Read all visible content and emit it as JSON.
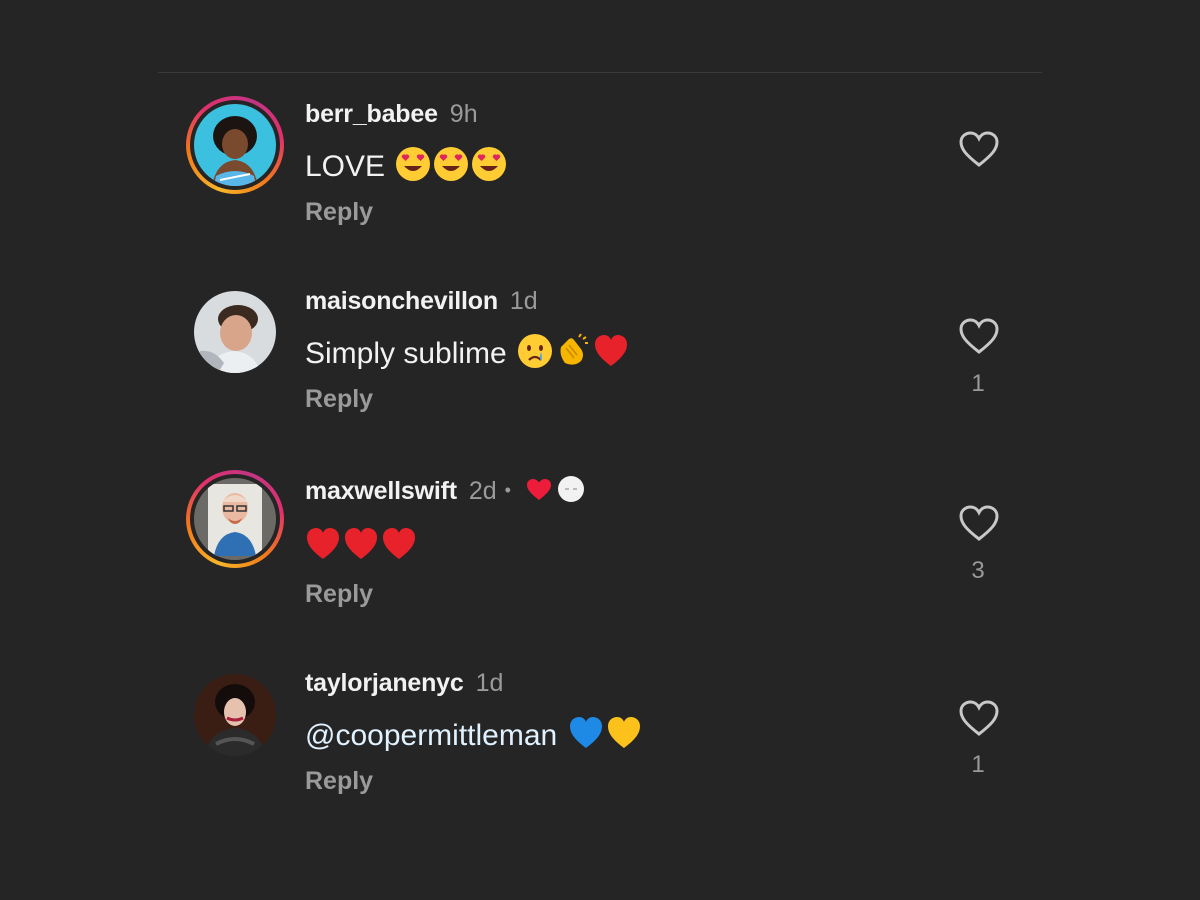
{
  "comments": [
    {
      "username": "berr_babee",
      "time": "9h",
      "text": "LOVE",
      "emojis": [
        "heart-eyes",
        "heart-eyes",
        "heart-eyes"
      ],
      "reply_label": "Reply",
      "likes": "",
      "story_ring": true
    },
    {
      "username": "maisonchevillon",
      "time": "1d",
      "text": "Simply sublime",
      "emojis": [
        "crying-face",
        "clapping-hands",
        "red-heart"
      ],
      "reply_label": "Reply",
      "likes": "1",
      "story_ring": false
    },
    {
      "username": "maxwellswift",
      "time": "2d",
      "separator": "•",
      "author_reactions": [
        "red-heart",
        "author-avatar"
      ],
      "text": "",
      "emojis": [
        "red-heart",
        "red-heart",
        "red-heart"
      ],
      "reply_label": "Reply",
      "likes": "3",
      "story_ring": true
    },
    {
      "username": "taylorjanenyc",
      "time": "1d",
      "text": "@coopermittleman",
      "emojis": [
        "blue-heart",
        "yellow-heart"
      ],
      "reply_label": "Reply",
      "likes": "1",
      "story_ring": false
    }
  ],
  "colors": {
    "background": "#252525",
    "text": "#f2f2f2",
    "muted": "#9a9a9a",
    "mention": "#e0f1ff",
    "ring_start": "#f8b62a",
    "ring_end": "#c13584"
  }
}
